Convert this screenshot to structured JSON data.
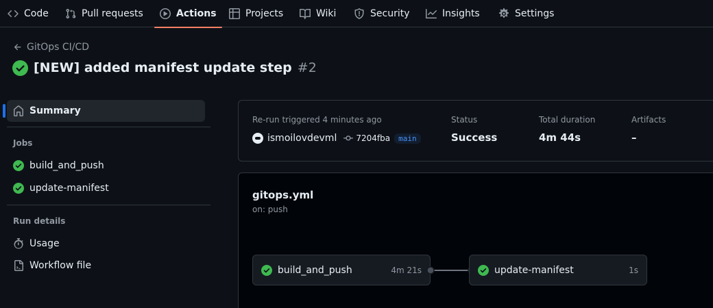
{
  "repo_nav": {
    "items": [
      {
        "label": "Code",
        "icon": "code-icon"
      },
      {
        "label": "Pull requests",
        "icon": "git-pull-request-icon"
      },
      {
        "label": "Actions",
        "icon": "play-icon",
        "active": true
      },
      {
        "label": "Projects",
        "icon": "table-icon"
      },
      {
        "label": "Wiki",
        "icon": "book-icon"
      },
      {
        "label": "Security",
        "icon": "shield-icon"
      },
      {
        "label": "Insights",
        "icon": "graph-icon"
      },
      {
        "label": "Settings",
        "icon": "gear-icon"
      }
    ]
  },
  "header": {
    "back_label": "GitOps CI/CD",
    "title": "[NEW] added manifest update step",
    "run_number": "#2",
    "status_icon": "check-circle-fill-icon"
  },
  "sidebar": {
    "summary_label": "Summary",
    "jobs_heading": "Jobs",
    "jobs": [
      {
        "label": "build_and_push",
        "status": "success"
      },
      {
        "label": "update-manifest",
        "status": "success"
      }
    ],
    "run_details_heading": "Run details",
    "run_details": [
      {
        "label": "Usage",
        "icon": "stopwatch-icon"
      },
      {
        "label": "Workflow file",
        "icon": "file-icon"
      }
    ]
  },
  "summary": {
    "trigger_label": "Re-run triggered 4 minutes ago",
    "actor": "ismoilovdevml",
    "commit": "7204fba",
    "branch": "main",
    "status_label": "Status",
    "status_value": "Success",
    "duration_label": "Total duration",
    "duration_value": "4m 44s",
    "artifacts_label": "Artifacts",
    "artifacts_value": "–"
  },
  "graph": {
    "workflow_file": "gitops.yml",
    "trigger": "on: push",
    "jobs": [
      {
        "name": "build_and_push",
        "duration": "4m 21s",
        "status": "success"
      },
      {
        "name": "update-manifest",
        "duration": "1s",
        "status": "success"
      }
    ]
  },
  "colors": {
    "background": "#0d1117",
    "success": "#3fb950",
    "active_tab_underline": "#f78166",
    "selected_indicator": "#1f6feb",
    "branch_text": "#4493f8"
  }
}
